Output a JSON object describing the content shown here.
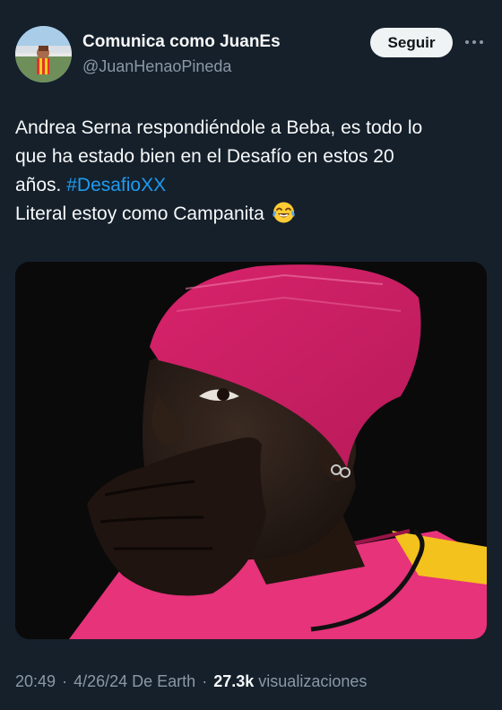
{
  "author": {
    "display_name": "Comunica como JuanEs",
    "handle": "@JuanHenaoPineda"
  },
  "actions": {
    "follow_label": "Seguir",
    "more_icon": "more-horizontal-icon"
  },
  "tweet": {
    "text_line_1": "Andrea Serna respondiéndole a Beba, es todo lo",
    "text_line_2": "que ha estado bien en el Desafío en estos 20",
    "text_line_3_prefix": "años. ",
    "hashtag": "#DesafioXX",
    "text_line_4": "Literal estoy como Campanita",
    "emoji": "face-with-tears-of-joy-emoji"
  },
  "meta": {
    "time": "20:49",
    "date": "4/26/24",
    "source": "De Earth",
    "separator": "·",
    "views_count": "27.3k",
    "views_label": "visualizaciones"
  },
  "colors": {
    "background": "#15202b",
    "text_primary": "#f7f9f9",
    "text_secondary": "#8b98a5",
    "link": "#1d9bf0",
    "follow_bg": "#eff3f4"
  }
}
